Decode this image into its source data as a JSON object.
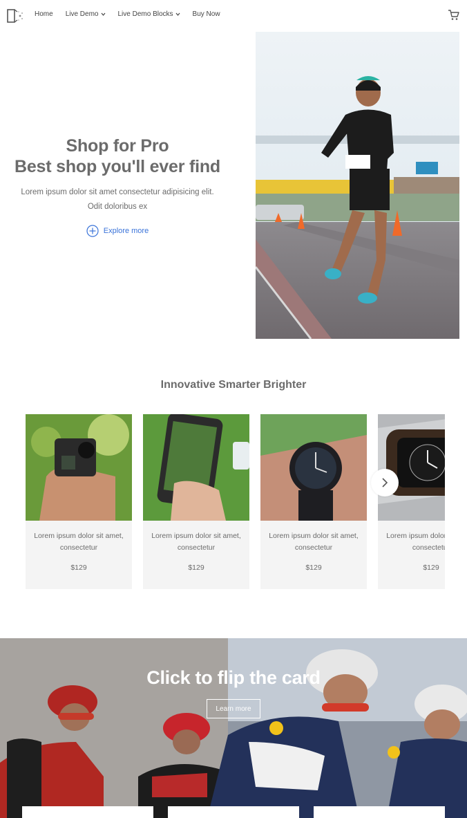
{
  "nav": {
    "links": [
      {
        "label": "Home",
        "has_chevron": false
      },
      {
        "label": "Live Demo",
        "has_chevron": true
      },
      {
        "label": "Live Demo Blocks",
        "has_chevron": true
      },
      {
        "label": "Buy Now",
        "has_chevron": false
      }
    ],
    "logo_icon": "brand-logo-icon",
    "cart_icon": "cart-icon"
  },
  "hero": {
    "title_line1": "Shop for Pro",
    "title_line2": "Best shop you'll ever find",
    "description": "Lorem ipsum dolor sit amet consectetur adipisicing elit. Odit doloribus ex",
    "cta_label": "Explore more",
    "cta_icon": "plus-circle-icon",
    "accent_color": "#3a73d9"
  },
  "products": {
    "title": "Innovative Smarter Brighter",
    "items": [
      {
        "desc": "Lorem ipsum dolor sit amet, consectetur",
        "price": "$129",
        "image": "action-camera"
      },
      {
        "desc": "Lorem ipsum dolor sit amet, consectetur",
        "price": "$129",
        "image": "smartphone"
      },
      {
        "desc": "Lorem ipsum dolor sit amet, consectetur",
        "price": "$129",
        "image": "smartwatch"
      },
      {
        "desc": "Lorem ipsum dolor sit amet, consectetur",
        "price": "$129",
        "image": "watch"
      }
    ],
    "next_icon": "chevron-right-icon"
  },
  "flip": {
    "title": "Click to flip the card",
    "button_label": "Learn more"
  }
}
